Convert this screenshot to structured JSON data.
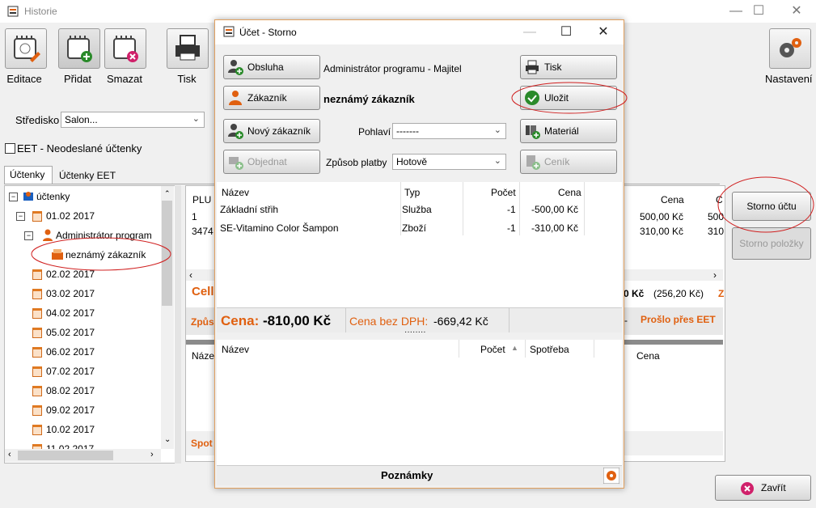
{
  "window": {
    "title": "Historie"
  },
  "toolbar": {
    "editace": "Editace",
    "pridat": "Přidat",
    "smazat": "Smazat",
    "tisk": "Tisk",
    "nastaveni": "Nastavení"
  },
  "filters": {
    "stredisko_label": "Středisko",
    "stredisko_value": "Salon...",
    "eet_checkbox_label": "EET - Neodeslané účtenky"
  },
  "tabs": {
    "uctenky": "Účtenky",
    "uctenky_eet": "Účtenky EET"
  },
  "tree": {
    "root": "účtenky",
    "date_first": "01.02 2017",
    "admin": "Administrátor program",
    "customer": "neznámý zákazník",
    "dates": [
      "02.02 2017",
      "03.02 2017",
      "04.02 2017",
      "05.02 2017",
      "06.02 2017",
      "07.02 2017",
      "08.02 2017",
      "09.02 2017",
      "10.02 2017",
      "11.02 2017"
    ]
  },
  "background_grid": {
    "col_plu": "PLU",
    "col_cena": "Cena",
    "col_c": "C",
    "rows": [
      {
        "plu": "1",
        "cena": "500,00 Kč",
        "c": "500"
      },
      {
        "plu": "3474",
        "cena": "310,00 Kč",
        "c": "310"
      }
    ],
    "celk": "Cell",
    "total_partial": "0 Kč",
    "total_paren": "(256,20 Kč)",
    "total_z": "Z",
    "zpus": "Způs",
    "dash": "--",
    "proslo": "Prošlo přes EET",
    "nazev": "Náze",
    "cena2": "Cena",
    "spot": "Spot"
  },
  "right_panel": {
    "storno_uctu": "Storno účtu",
    "storno_polozky": "Storno položky",
    "zavrit": "Zavřít"
  },
  "dialog": {
    "title": "Účet - Storno",
    "obsluha_btn": "Obsluha",
    "obsluha_value": "Administrátor programu - Majitel",
    "zakaznik_btn": "Zákazník",
    "zakaznik_value": "neznámý zákazník",
    "novy_zakaznik_btn": "Nový zákazník",
    "pohlavi_label": "Pohlaví",
    "pohlavi_value": "-------",
    "objednat_btn": "Objednat",
    "zpusob_platby_label": "Způsob platby",
    "zpusob_platby_value": "Hotově",
    "tisk_btn": "Tisk",
    "ulozit_btn": "Uložit",
    "material_btn": "Materiál",
    "cenik_btn": "Ceník",
    "items_columns": {
      "nazev": "Název",
      "typ": "Typ",
      "pocet": "Počet",
      "cena": "Cena"
    },
    "items": [
      {
        "nazev": "Základní střih",
        "typ": "Služba",
        "pocet": "-1",
        "cena": "-500,00 Kč"
      },
      {
        "nazev": "SE-Vitamino Color Šampon",
        "typ": "Zboží",
        "pocet": "-1",
        "cena": "-310,00 Kč"
      }
    ],
    "cena_label": "Cena:",
    "cena_value": "-810,00 Kč",
    "cena_bez_dph_label": "Cena bez DPH:",
    "cena_bez_dph_value": "-669,42 Kč",
    "material_columns": {
      "nazev": "Název",
      "pocet": "Počet",
      "spotreba": "Spotřeba"
    },
    "poznamky": "Poznámky"
  }
}
